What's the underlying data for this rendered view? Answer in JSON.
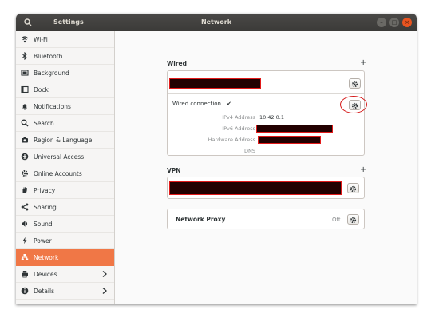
{
  "titlebar": {
    "left_title": "Settings",
    "center_title": "Network",
    "search_icon": "search-icon",
    "menu_icon": "hamburger-menu-icon"
  },
  "sidebar": {
    "items": [
      {
        "label": "Wi-Fi",
        "icon": "wifi-icon"
      },
      {
        "label": "Bluetooth",
        "icon": "bluetooth-icon"
      },
      {
        "label": "Background",
        "icon": "background-icon"
      },
      {
        "label": "Dock",
        "icon": "dock-icon"
      },
      {
        "label": "Notifications",
        "icon": "bell-icon"
      },
      {
        "label": "Search",
        "icon": "search-icon"
      },
      {
        "label": "Region & Language",
        "icon": "camera-icon"
      },
      {
        "label": "Universal Access",
        "icon": "accessibility-icon"
      },
      {
        "label": "Online Accounts",
        "icon": "gear-icon"
      },
      {
        "label": "Privacy",
        "icon": "hand-icon"
      },
      {
        "label": "Sharing",
        "icon": "share-icon"
      },
      {
        "label": "Sound",
        "icon": "speaker-icon"
      },
      {
        "label": "Power",
        "icon": "power-icon"
      },
      {
        "label": "Network",
        "icon": "network-icon",
        "active": true
      },
      {
        "label": "Devices",
        "icon": "printer-icon",
        "chevron": true
      },
      {
        "label": "Details",
        "icon": "info-icon",
        "chevron": true
      }
    ]
  },
  "wired": {
    "title": "Wired",
    "add_label": "+",
    "connection_label": "Wired connection",
    "connected_mark": "✔",
    "details": [
      {
        "key": "IPv4 Address",
        "value": "10.42.0.1"
      },
      {
        "key": "IPv6 Address",
        "value": ""
      },
      {
        "key": "Hardware Address",
        "value": ""
      },
      {
        "key": "DNS",
        "value": ""
      }
    ]
  },
  "vpn": {
    "title": "VPN",
    "add_label": "+"
  },
  "proxy": {
    "label": "Network Proxy",
    "state": "Off"
  },
  "colors": {
    "accent": "#f07746",
    "titlebar": "#3c3b37",
    "redaction_border": "#e21a1a",
    "redaction_fill": "#220000"
  }
}
